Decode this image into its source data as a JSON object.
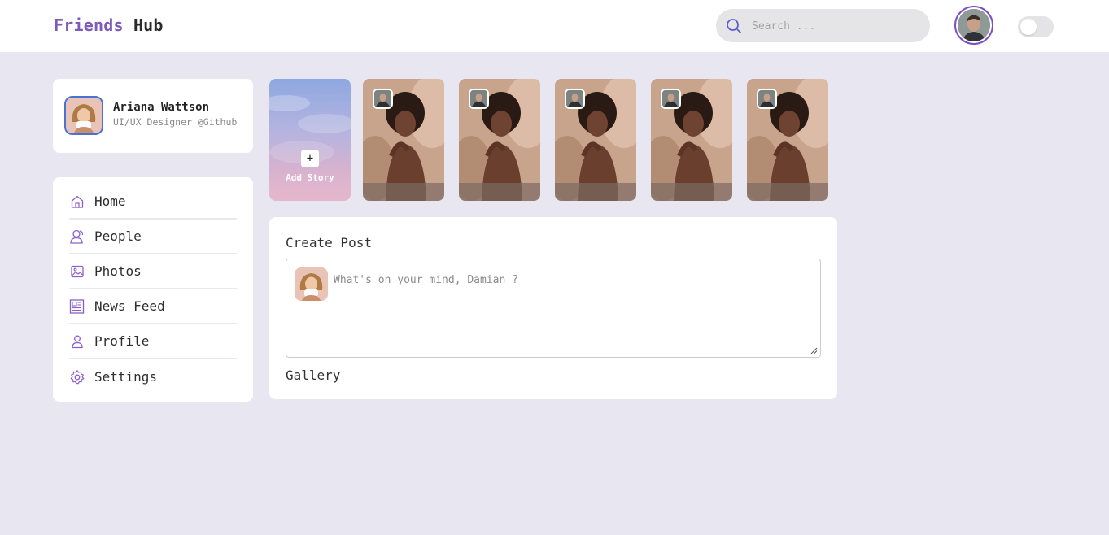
{
  "header": {
    "logo_part1": "Friends",
    "logo_part2": "Hub",
    "search_placeholder": "Search ...",
    "accent_color": "#7c5cb8"
  },
  "profile": {
    "name": "Ariana Wattson",
    "subtitle": "UI/UX Designer @Github"
  },
  "sidebar": {
    "items": [
      {
        "label": "Home",
        "icon": "home-icon"
      },
      {
        "label": "People",
        "icon": "people-icon"
      },
      {
        "label": "Photos",
        "icon": "image-icon"
      },
      {
        "label": "News Feed",
        "icon": "newspaper-icon"
      },
      {
        "label": "Profile",
        "icon": "user-icon"
      },
      {
        "label": "Settings",
        "icon": "gear-icon"
      }
    ]
  },
  "stories": {
    "add_label": "Add Story",
    "add_icon": "+",
    "count": 5
  },
  "create_post": {
    "title": "Create Post",
    "placeholder": "What's on your mind, Damian ?",
    "gallery_label": "Gallery"
  }
}
